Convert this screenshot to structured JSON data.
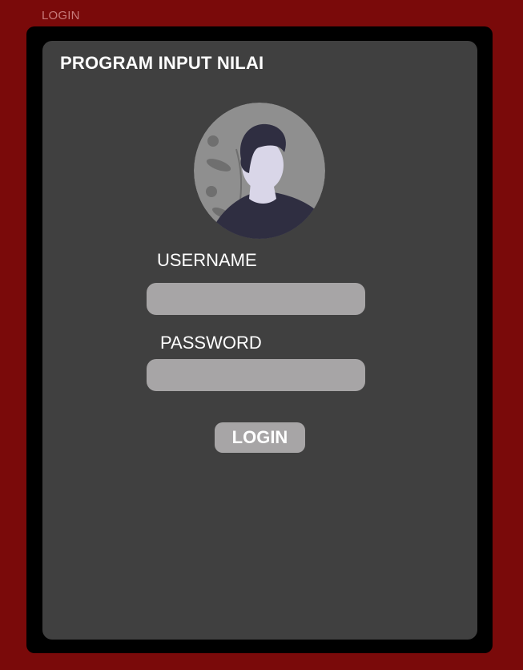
{
  "frame": {
    "label": "LOGIN"
  },
  "app": {
    "title": "PROGRAM INPUT NILAI"
  },
  "avatar": {
    "icon": "user-avatar-icon"
  },
  "form": {
    "username_label": "USERNAME",
    "username_value": "",
    "password_label": "PASSWORD",
    "password_value": "",
    "login_label": "LOGIN"
  },
  "colors": {
    "background": "#7a0a0a",
    "device": "#000000",
    "panel": "#404040",
    "input": "#a7a5a6",
    "text": "#ffffff",
    "avatar_circle": "#8f8f8f",
    "avatar_hair": "#2f2e41",
    "avatar_skin": "#d9d6e8"
  }
}
